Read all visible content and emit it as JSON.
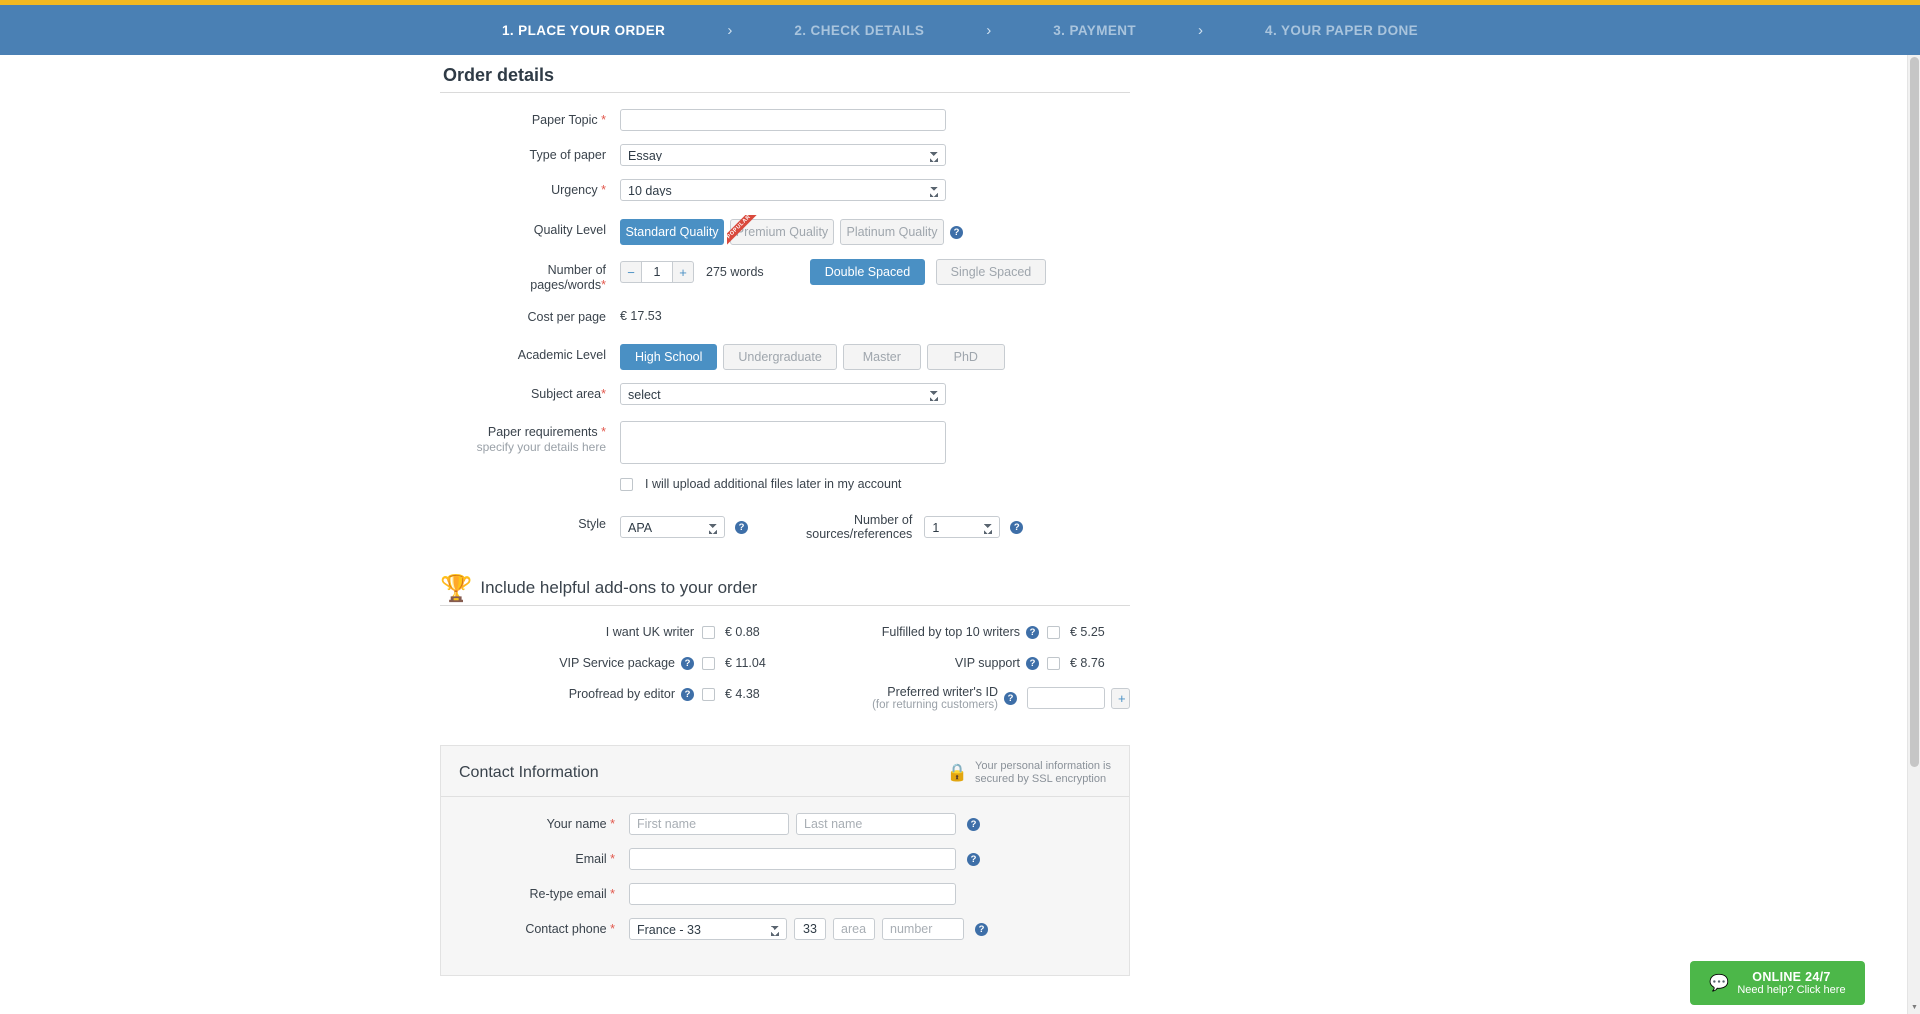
{
  "steps": {
    "items": [
      {
        "label": "1. PLACE YOUR ORDER",
        "active": true
      },
      {
        "label": "2. CHECK DETAILS",
        "active": false
      },
      {
        "label": "3. PAYMENT",
        "active": false
      },
      {
        "label": "4. YOUR PAPER DONE",
        "active": false
      }
    ],
    "separator": "›",
    "active_color": "#ffffff",
    "inactive_color": "#a9c4dd",
    "bar_color": "#4a80b4",
    "accent_strip_color": "#f2b822"
  },
  "order": {
    "title": "Order details",
    "paper_topic": {
      "label": "Paper Topic",
      "required": "*",
      "value": "",
      "placeholder": ""
    },
    "type_of_paper": {
      "label": "Type of paper",
      "value": "Essay"
    },
    "urgency": {
      "label": "Urgency",
      "required": "*",
      "value": "10 days"
    },
    "quality": {
      "label": "Quality Level",
      "options": [
        "Standard Quality",
        "Premium Quality",
        "Platinum Quality"
      ],
      "selected": "Standard Quality",
      "ribbon": "POPULAR"
    },
    "pages": {
      "label": "Number of",
      "label2": "pages/words",
      "required": "*",
      "minus": "−",
      "plus": "+",
      "value": "1",
      "words": "275 words",
      "spacing_options": [
        "Double Spaced",
        "Single Spaced"
      ],
      "spacing_selected": "Double Spaced"
    },
    "cost_per_page": {
      "label": "Cost per page",
      "value": "€ 17.53"
    },
    "academic_level": {
      "label": "Academic Level",
      "options": [
        "High School",
        "Undergraduate",
        "Master",
        "PhD"
      ],
      "selected": "High School"
    },
    "subject_area": {
      "label": "Subject area",
      "required": "*",
      "value": "select"
    },
    "paper_requirements": {
      "label": "Paper requirements",
      "required": "*",
      "sub": "specify your details here",
      "value": "",
      "placeholder": ""
    },
    "upload_later": {
      "text": "I will upload additional files later in my account",
      "checked": false
    },
    "style": {
      "label": "Style",
      "value": "APA",
      "help": "?"
    },
    "sources": {
      "label_line1": "Number of",
      "label_line2": "sources/references",
      "value": "1",
      "help": "?"
    }
  },
  "addons": {
    "title": "Include helpful add-ons to your order",
    "trophy_icon": "🏆",
    "left": [
      {
        "name": "I want UK writer",
        "help": false,
        "price": "€ 0.88",
        "checked": false
      },
      {
        "name": "VIP Service package",
        "help": true,
        "price": "€ 11.04",
        "checked": false
      },
      {
        "name": "Proofread by editor",
        "help": true,
        "price": "€ 4.38",
        "checked": false
      }
    ],
    "right": [
      {
        "name": "Fulfilled by top 10 writers",
        "help": true,
        "price": "€ 5.25",
        "checked": false
      },
      {
        "name": "VIP support",
        "help": true,
        "price": "€ 8.76",
        "checked": false
      },
      {
        "name": "Preferred writer's ID",
        "note": "(for returning customers)",
        "help": true,
        "input_value": "",
        "plus": "+"
      }
    ]
  },
  "contact": {
    "title": "Contact Information",
    "lock_icon": "🔒",
    "ssl_line1": "Your personal information is",
    "ssl_line2": "secured by SSL encryption",
    "your_name": {
      "label": "Your name",
      "required": "*",
      "first_placeholder": "First name",
      "first_value": "",
      "last_placeholder": "Last name",
      "last_value": "",
      "help": "?"
    },
    "email": {
      "label": "Email",
      "required": "*",
      "value": "",
      "placeholder": "",
      "help": "?"
    },
    "retype_email": {
      "label": "Re-type email",
      "required": "*",
      "value": "",
      "placeholder": ""
    },
    "phone": {
      "label": "Contact phone",
      "required": "*",
      "country": "France - 33",
      "code": "33",
      "area_placeholder": "area",
      "area_value": "",
      "number_placeholder": "number",
      "number_value": "",
      "help": "?"
    }
  },
  "chat": {
    "icon": "💬",
    "line1": "ONLINE 24/7",
    "line2": "Need help? Click here",
    "color": "#4cb749"
  },
  "scrollbar": {
    "up": "▲",
    "down": "▼"
  }
}
